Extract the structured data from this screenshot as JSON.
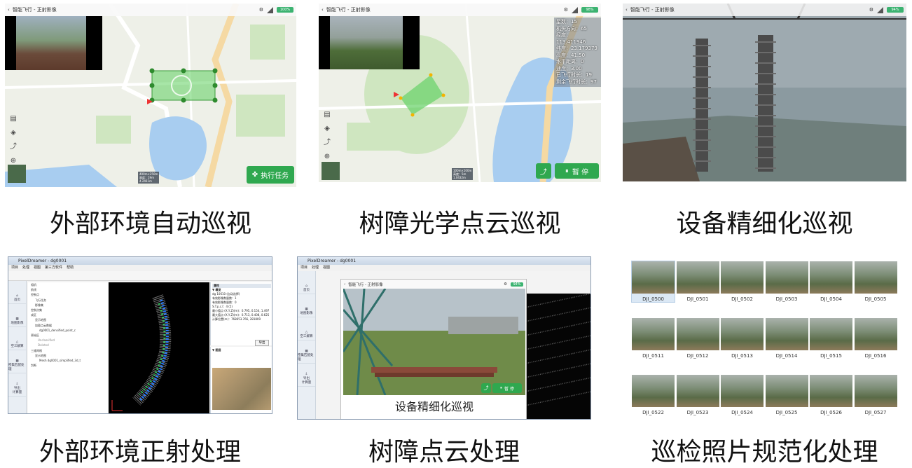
{
  "app": {
    "title": "智能飞行 - 正射影像",
    "battery_1": "100%",
    "battery_2": "98%",
    "battery_3": "94%"
  },
  "panels": {
    "p1": {
      "button": "执行任务",
      "scale": "400m×250m\n高度：19m\n4.2461m"
    },
    "p2": {
      "stats": [
        "星数：15",
        "机头方向：65",
        "经度：113.411946",
        "纬度：23.179379",
        "高度：41.50",
        "水平距离：0",
        "速度：3.00",
        "已飞行时长：19",
        "剩余飞行时长：97"
      ],
      "pause_button": "暂 停",
      "scale": "100m×100m\n高度：5m\n1.0432m"
    },
    "p4": {
      "window_title": "PixelDreamer - dg0001",
      "menu": [
        "项目",
        "处理",
        "视图",
        "第三方软件",
        "帮助"
      ],
      "nav": [
        "首页",
        "地图影像",
        "空三解算",
        "密集匹配处理",
        "导出\n计算量"
      ],
      "tree": [
        "相机",
        "航线",
        "控制点",
        "飞行任务",
        "影像集",
        "控制点集",
        "成区",
        "显示地图",
        "加载点云数据",
        "dg0001_densified_point_c",
        "原始区",
        "Unclassified",
        "Deleted",
        "三维网格",
        "显示地图",
        "Mesh dg0001_simplified_3d_t",
        "判断"
      ],
      "props_header": "属性",
      "props_section": "▼ 概览",
      "props": [
        "dg 10610 (自动选择)",
        "有效影像数量数：1",
        "有效影像数量数：0",
        "S.T.p.c.l：4 (5)",
        "最小值点 (X,Y,Z)(m)：0.795, 0.154, 1.497",
        "最大值点 (X,Y,Z)(m)：0.713, 0.408, 0.625",
        "计算位置(m)：768653.766, 281809"
      ],
      "section2": "▼ 图层",
      "export_button": "导出"
    },
    "p5": {
      "window_title": "PixelDreamer - dg0001",
      "inner_title": "智能飞行 - 正射影像",
      "overlay_caption": "设备精细化巡视",
      "pause_button": "暂 停"
    },
    "p6": {
      "photos": [
        "DJI_0500",
        "DJI_0501",
        "DJI_0502",
        "DJI_0503",
        "DJI_0504",
        "DJI_0505",
        "DJI_0511",
        "DJI_0512",
        "DJI_0513",
        "DJI_0514",
        "DJI_0515",
        "DJI_0516",
        "DJI_0522",
        "DJI_0523",
        "DJI_0524",
        "DJI_0525",
        "DJI_0526",
        "DJI_0527"
      ]
    }
  },
  "captions": [
    "外部环境自动巡视",
    "树障光学点云巡视",
    "设备精细化巡视",
    "外部环境正射处理",
    "树障点云处理",
    "巡检照片规范化处理"
  ]
}
